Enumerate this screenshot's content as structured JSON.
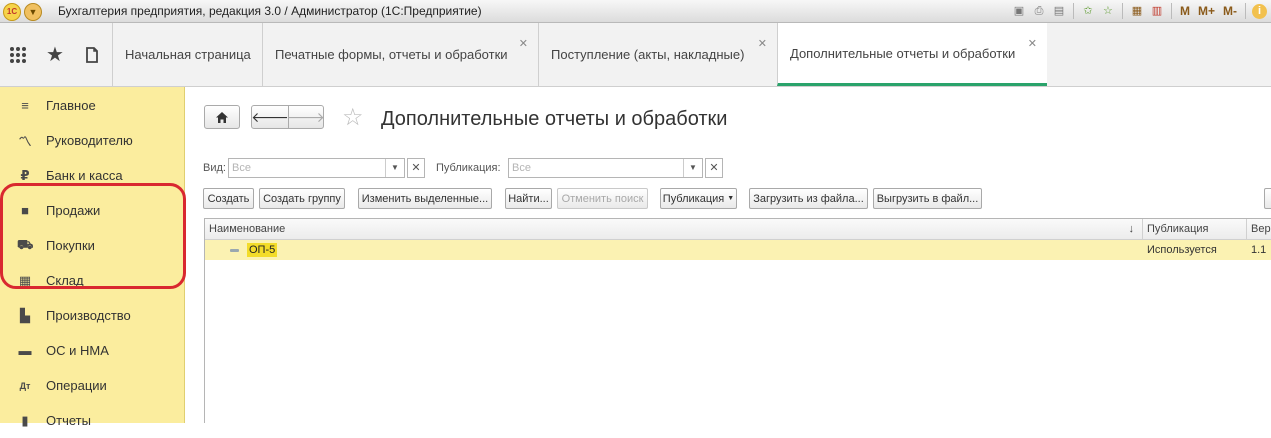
{
  "window": {
    "title": "Бухгалтерия предприятия, редакция 3.0 / Администратор  (1С:Предприятие)",
    "logo_text": "1С",
    "toolbar_m_buttons": [
      "M",
      "M+",
      "M-"
    ]
  },
  "tabs": [
    {
      "label": "Начальная страница",
      "closable": false
    },
    {
      "label": "Печатные формы, отчеты и обработки",
      "closable": true
    },
    {
      "label": "Поступление (акты, накладные)",
      "closable": true
    },
    {
      "label": "Дополнительные отчеты и обработки",
      "closable": true,
      "active": true
    }
  ],
  "sidebar": {
    "items": [
      {
        "label": "Главное",
        "icon": "menu-lines-icon"
      },
      {
        "label": "Руководителю",
        "icon": "trend-chart-icon"
      },
      {
        "label": "Банк и касса",
        "icon": "ruble-coin-icon"
      },
      {
        "label": "Продажи",
        "icon": "shopping-bag-icon"
      },
      {
        "label": "Покупки",
        "icon": "cart-icon"
      },
      {
        "label": "Склад",
        "icon": "warehouse-grid-icon"
      },
      {
        "label": "Производство",
        "icon": "factory-icon"
      },
      {
        "label": "ОС и НМА",
        "icon": "truck-icon"
      },
      {
        "label": "Операции",
        "icon": "dt-kt-icon"
      },
      {
        "label": "Отчеты",
        "icon": "report-icon"
      }
    ]
  },
  "page": {
    "title": "Дополнительные отчеты и обработки"
  },
  "filters": {
    "vid_label": "Вид:",
    "vid_placeholder": "Все",
    "publication_label": "Публикация:",
    "publication_placeholder": "Все"
  },
  "toolbar": {
    "create": "Создать",
    "create_group": "Создать группу",
    "change_selected": "Изменить выделенные...",
    "find": "Найти...",
    "cancel_search": "Отменить поиск",
    "publication": "Публикация",
    "load_from_file": "Загрузить из файла...",
    "save_to_file": "Выгрузить в файл..."
  },
  "table": {
    "columns": [
      "Наименование",
      "Публикация",
      "Вер"
    ],
    "rows": [
      {
        "name": "ОП-5",
        "publication": "Используется",
        "version": "1.1"
      }
    ]
  },
  "colors": {
    "sidebar_bg": "#fbed9e",
    "active_tab_accent": "#2aa36b",
    "selected_row": "#fbf2b2",
    "annotation_red": "#d9282f"
  }
}
